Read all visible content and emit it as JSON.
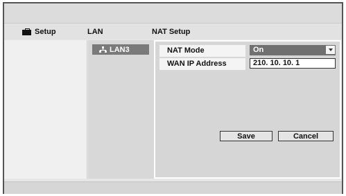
{
  "header": {
    "setup_label": "Setup",
    "lan_label": "LAN",
    "nat_label": "NAT Setup"
  },
  "sidebar": {
    "selected_item": "LAN3"
  },
  "form": {
    "nat_mode": {
      "label": "NAT Mode",
      "value": "On",
      "options_visible": [
        "On"
      ]
    },
    "wan_ip": {
      "label": "WAN IP Address",
      "value": "210. 10. 10. 1"
    }
  },
  "buttons": {
    "save": "Save",
    "cancel": "Cancel"
  },
  "icons": {
    "setup": "toolbox-icon",
    "lan": "network-icon",
    "dropdown": "chevron-down-icon"
  }
}
